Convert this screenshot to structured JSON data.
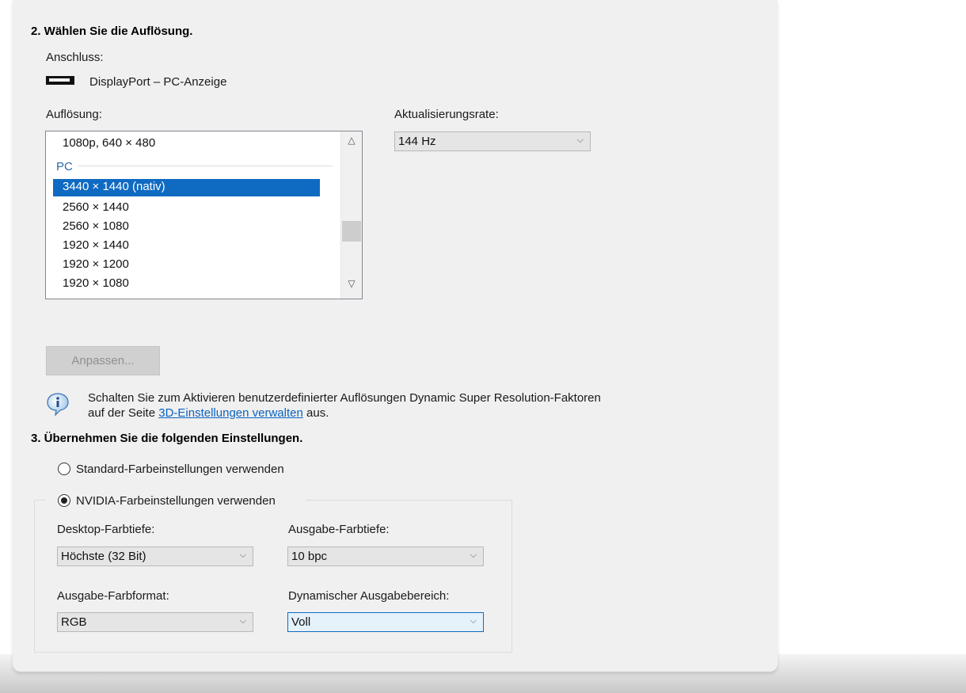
{
  "section2": {
    "heading": "2. Wählen Sie die Auflösung.",
    "connection_label": "Anschluss:",
    "connection_value": "DisplayPort – PC-Anzeige",
    "resolution_label": "Auflösung:",
    "refresh_label": "Aktualisierungsrate:",
    "refresh_value": "144 Hz",
    "resolution_list": {
      "top_item": "1080p, 640 × 480",
      "group": "PC",
      "selected": "3440 × 1440 (nativ)",
      "items": [
        "2560 × 1440",
        "2560 × 1080",
        "1920 × 1440",
        "1920 × 1200",
        "1920 × 1080"
      ]
    },
    "customize_button": "Anpassen...",
    "info_text_1": "Schalten Sie zum Aktivieren benutzerdefinierter Auflösungen Dynamic Super Resolution-Faktoren",
    "info_text_2_prefix": "auf der Seite",
    "info_link": "3D-Einstellungen verwalten",
    "info_text_2_suffix": "aus."
  },
  "section3": {
    "heading": "3. Übernehmen Sie die folgenden Einstellungen.",
    "radio_default": "Standard-Farbeinstellungen verwenden",
    "radio_nvidia": "NVIDIA-Farbeinstellungen verwenden",
    "desktop_depth_label": "Desktop-Farbtiefe:",
    "desktop_depth_value": "Höchste (32 Bit)",
    "output_depth_label": "Ausgabe-Farbtiefe:",
    "output_depth_value": "10 bpc",
    "output_format_label": "Ausgabe-Farbformat:",
    "output_format_value": "RGB",
    "dynamic_range_label": "Dynamischer Ausgabebereich:",
    "dynamic_range_value": "Voll"
  },
  "icons": {
    "display": "display-icon",
    "info": "info-icon",
    "scroll_up": "chevron-up-icon",
    "scroll_down": "chevron-down-icon",
    "combo": "chevron-down-icon"
  },
  "colors": {
    "selection": "#0f6ac2",
    "link": "#0b63c0",
    "group_header": "#2a6aa8"
  }
}
